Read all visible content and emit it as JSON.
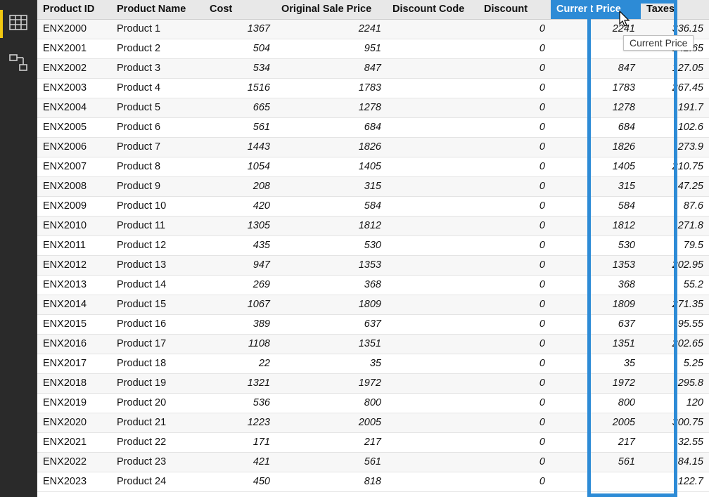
{
  "headers": {
    "product_id": "Product ID",
    "product_name": "Product Name",
    "cost": "Cost",
    "original_sale_price": "Original Sale Price",
    "discount_code": "Discount Code",
    "discount": "Discount",
    "current_price": "Current Price",
    "taxes": "Taxes"
  },
  "tooltip": "Current Price",
  "rows": [
    {
      "pid": "ENX2000",
      "name": "Product 1",
      "cost": "1367",
      "osp": "2241",
      "dc": "",
      "disc": "0",
      "cp": "2241",
      "tax": "336.15"
    },
    {
      "pid": "ENX2001",
      "name": "Product 2",
      "cost": "504",
      "osp": "951",
      "dc": "",
      "disc": "0",
      "cp": "",
      "tax": "142.65"
    },
    {
      "pid": "ENX2002",
      "name": "Product 3",
      "cost": "534",
      "osp": "847",
      "dc": "",
      "disc": "0",
      "cp": "847",
      "tax": "127.05"
    },
    {
      "pid": "ENX2003",
      "name": "Product 4",
      "cost": "1516",
      "osp": "1783",
      "dc": "",
      "disc": "0",
      "cp": "1783",
      "tax": "267.45"
    },
    {
      "pid": "ENX2004",
      "name": "Product 5",
      "cost": "665",
      "osp": "1278",
      "dc": "",
      "disc": "0",
      "cp": "1278",
      "tax": "191.7"
    },
    {
      "pid": "ENX2005",
      "name": "Product 6",
      "cost": "561",
      "osp": "684",
      "dc": "",
      "disc": "0",
      "cp": "684",
      "tax": "102.6"
    },
    {
      "pid": "ENX2006",
      "name": "Product 7",
      "cost": "1443",
      "osp": "1826",
      "dc": "",
      "disc": "0",
      "cp": "1826",
      "tax": "273.9"
    },
    {
      "pid": "ENX2007",
      "name": "Product 8",
      "cost": "1054",
      "osp": "1405",
      "dc": "",
      "disc": "0",
      "cp": "1405",
      "tax": "210.75"
    },
    {
      "pid": "ENX2008",
      "name": "Product 9",
      "cost": "208",
      "osp": "315",
      "dc": "",
      "disc": "0",
      "cp": "315",
      "tax": "47.25"
    },
    {
      "pid": "ENX2009",
      "name": "Product 10",
      "cost": "420",
      "osp": "584",
      "dc": "",
      "disc": "0",
      "cp": "584",
      "tax": "87.6"
    },
    {
      "pid": "ENX2010",
      "name": "Product 11",
      "cost": "1305",
      "osp": "1812",
      "dc": "",
      "disc": "0",
      "cp": "1812",
      "tax": "271.8"
    },
    {
      "pid": "ENX2011",
      "name": "Product 12",
      "cost": "435",
      "osp": "530",
      "dc": "",
      "disc": "0",
      "cp": "530",
      "tax": "79.5"
    },
    {
      "pid": "ENX2012",
      "name": "Product 13",
      "cost": "947",
      "osp": "1353",
      "dc": "",
      "disc": "0",
      "cp": "1353",
      "tax": "202.95"
    },
    {
      "pid": "ENX2013",
      "name": "Product 14",
      "cost": "269",
      "osp": "368",
      "dc": "",
      "disc": "0",
      "cp": "368",
      "tax": "55.2"
    },
    {
      "pid": "ENX2014",
      "name": "Product 15",
      "cost": "1067",
      "osp": "1809",
      "dc": "",
      "disc": "0",
      "cp": "1809",
      "tax": "271.35"
    },
    {
      "pid": "ENX2015",
      "name": "Product 16",
      "cost": "389",
      "osp": "637",
      "dc": "",
      "disc": "0",
      "cp": "637",
      "tax": "95.55"
    },
    {
      "pid": "ENX2016",
      "name": "Product 17",
      "cost": "1108",
      "osp": "1351",
      "dc": "",
      "disc": "0",
      "cp": "1351",
      "tax": "202.65"
    },
    {
      "pid": "ENX2017",
      "name": "Product 18",
      "cost": "22",
      "osp": "35",
      "dc": "",
      "disc": "0",
      "cp": "35",
      "tax": "5.25"
    },
    {
      "pid": "ENX2018",
      "name": "Product 19",
      "cost": "1321",
      "osp": "1972",
      "dc": "",
      "disc": "0",
      "cp": "1972",
      "tax": "295.8"
    },
    {
      "pid": "ENX2019",
      "name": "Product 20",
      "cost": "536",
      "osp": "800",
      "dc": "",
      "disc": "0",
      "cp": "800",
      "tax": "120"
    },
    {
      "pid": "ENX2020",
      "name": "Product 21",
      "cost": "1223",
      "osp": "2005",
      "dc": "",
      "disc": "0",
      "cp": "2005",
      "tax": "300.75"
    },
    {
      "pid": "ENX2021",
      "name": "Product 22",
      "cost": "171",
      "osp": "217",
      "dc": "",
      "disc": "0",
      "cp": "217",
      "tax": "32.55"
    },
    {
      "pid": "ENX2022",
      "name": "Product 23",
      "cost": "421",
      "osp": "561",
      "dc": "",
      "disc": "0",
      "cp": "561",
      "tax": "84.15"
    },
    {
      "pid": "ENX2023",
      "name": "Product 24",
      "cost": "450",
      "osp": "818",
      "dc": "",
      "disc": "0",
      "cp": "",
      "tax": "122.7"
    }
  ]
}
